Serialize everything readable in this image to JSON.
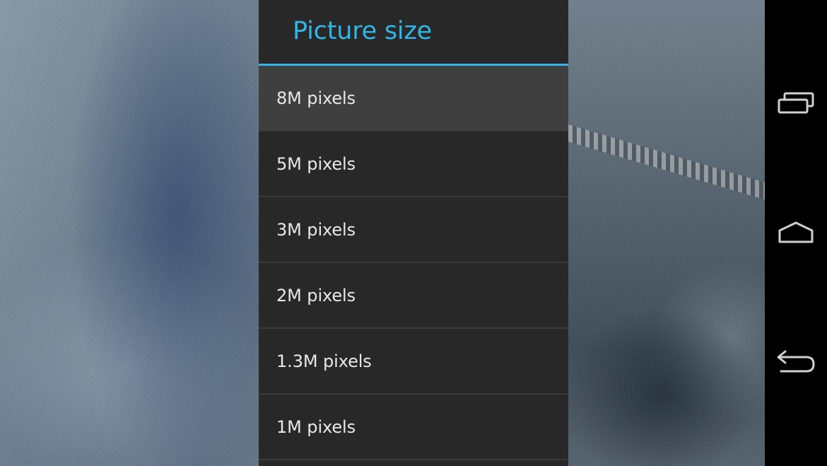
{
  "dialog": {
    "title": "Picture size",
    "accent_color": "#33b5e5",
    "options": [
      {
        "label": "8M pixels",
        "selected": true
      },
      {
        "label": "5M pixels",
        "selected": false
      },
      {
        "label": "3M pixels",
        "selected": false
      },
      {
        "label": "2M pixels",
        "selected": false
      },
      {
        "label": "1.3M pixels",
        "selected": false
      },
      {
        "label": "1M pixels",
        "selected": false
      }
    ]
  },
  "navbar": {
    "buttons": [
      {
        "icon": "recent-apps-icon"
      },
      {
        "icon": "home-icon"
      },
      {
        "icon": "back-icon"
      }
    ]
  }
}
